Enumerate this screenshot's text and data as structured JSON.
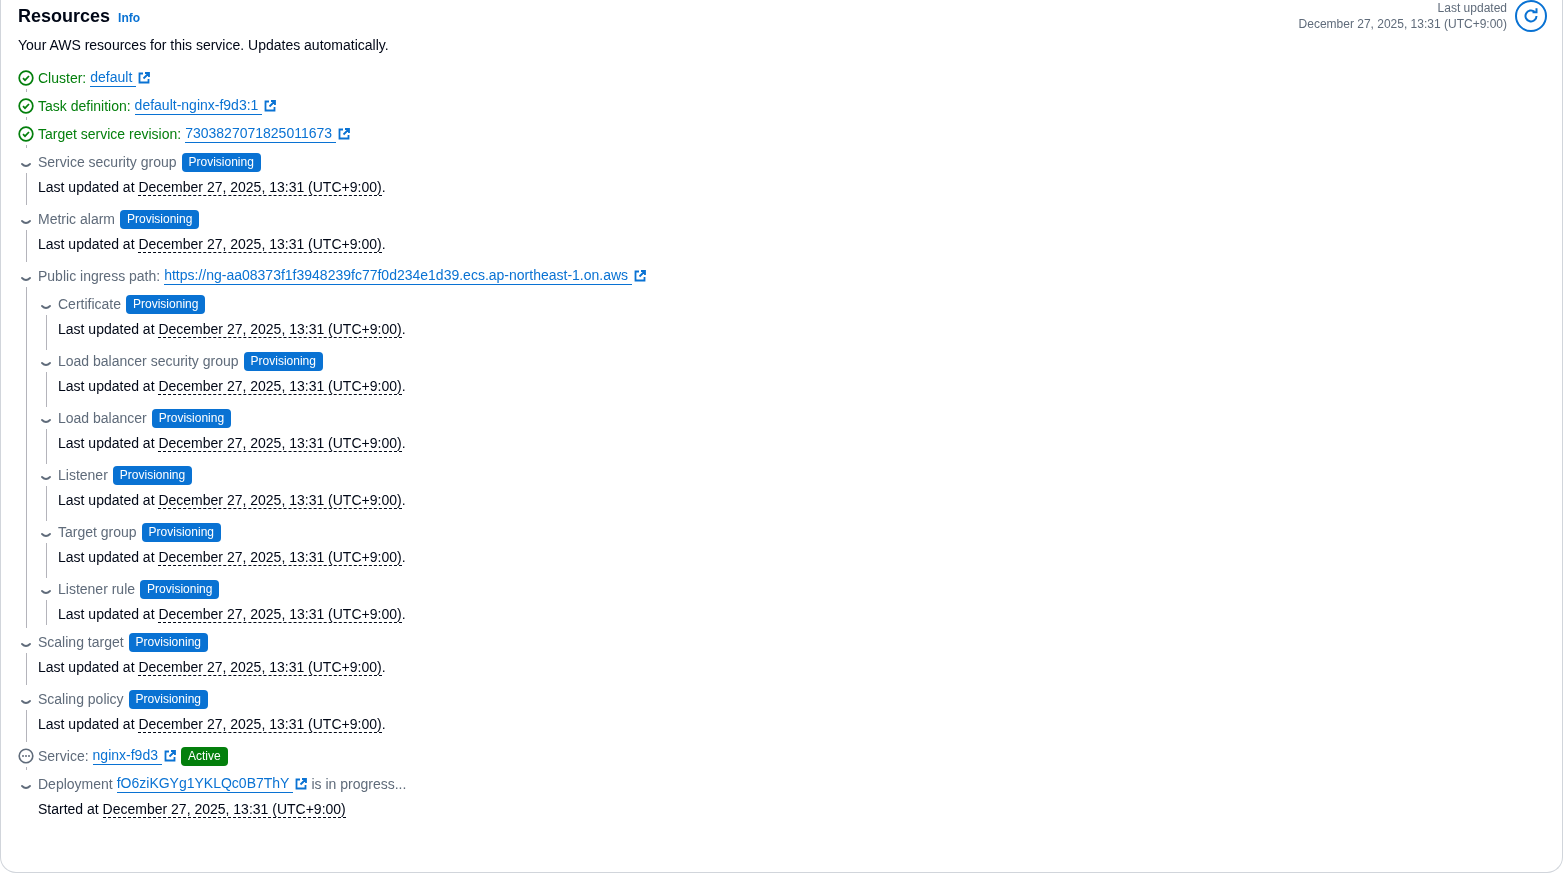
{
  "header": {
    "title": "Resources",
    "info": "Info",
    "description": "Your AWS resources for this service. Updates automatically.",
    "last_updated_label": "Last updated",
    "last_updated_value": "December 27, 2025, 13:31 (UTC+9:00)"
  },
  "items": [
    {
      "kind": "success",
      "label": "Cluster:",
      "link": "default"
    },
    {
      "kind": "success",
      "label": "Task definition:",
      "link": "default-nginx-f9d3:1"
    },
    {
      "kind": "success",
      "label": "Target service revision:",
      "link": "7303827071825011673"
    },
    {
      "kind": "pending",
      "label": "Service security group",
      "badge": {
        "text": "Provisioning",
        "kind": "info"
      },
      "detail": {
        "prefix": "Last updated at",
        "date": "December 27, 2025, 13:31 (UTC+9:00)",
        "suffix": "."
      }
    },
    {
      "kind": "pending",
      "label": "Metric alarm",
      "badge": {
        "text": "Provisioning",
        "kind": "info"
      },
      "detail": {
        "prefix": "Last updated at",
        "date": "December 27, 2025, 13:31 (UTC+9:00)",
        "suffix": "."
      }
    },
    {
      "kind": "pending",
      "label": "Public ingress path:",
      "link": "https://ng-aa08373f1f3948239fc77f0d234e1d39.ecs.ap-northeast-1.on.aws",
      "children": [
        {
          "kind": "pending",
          "label": "Certificate",
          "badge": {
            "text": "Provisioning",
            "kind": "info"
          },
          "detail": {
            "prefix": "Last updated at",
            "date": "December 27, 2025, 13:31 (UTC+9:00)",
            "suffix": "."
          }
        },
        {
          "kind": "pending",
          "label": "Load balancer security group",
          "badge": {
            "text": "Provisioning",
            "kind": "info"
          },
          "detail": {
            "prefix": "Last updated at",
            "date": "December 27, 2025, 13:31 (UTC+9:00)",
            "suffix": "."
          }
        },
        {
          "kind": "pending",
          "label": "Load balancer",
          "badge": {
            "text": "Provisioning",
            "kind": "info"
          },
          "detail": {
            "prefix": "Last updated at",
            "date": "December 27, 2025, 13:31 (UTC+9:00)",
            "suffix": "."
          }
        },
        {
          "kind": "pending",
          "label": "Listener",
          "badge": {
            "text": "Provisioning",
            "kind": "info"
          },
          "detail": {
            "prefix": "Last updated at",
            "date": "December 27, 2025, 13:31 (UTC+9:00)",
            "suffix": "."
          }
        },
        {
          "kind": "pending",
          "label": "Target group",
          "badge": {
            "text": "Provisioning",
            "kind": "info"
          },
          "detail": {
            "prefix": "Last updated at",
            "date": "December 27, 2025, 13:31 (UTC+9:00)",
            "suffix": "."
          }
        },
        {
          "kind": "pending",
          "label": "Listener rule",
          "badge": {
            "text": "Provisioning",
            "kind": "info"
          },
          "detail": {
            "prefix": "Last updated at",
            "date": "December 27, 2025, 13:31 (UTC+9:00)",
            "suffix": "."
          }
        }
      ]
    },
    {
      "kind": "pending",
      "label": "Scaling target",
      "badge": {
        "text": "Provisioning",
        "kind": "info"
      },
      "detail": {
        "prefix": "Last updated at",
        "date": "December 27, 2025, 13:31 (UTC+9:00)",
        "suffix": "."
      }
    },
    {
      "kind": "pending",
      "label": "Scaling policy",
      "badge": {
        "text": "Provisioning",
        "kind": "info"
      },
      "detail": {
        "prefix": "Last updated at",
        "date": "December 27, 2025, 13:31 (UTC+9:00)",
        "suffix": "."
      }
    },
    {
      "kind": "in_progress",
      "label": "Service:",
      "link": "nginx-f9d3",
      "badge": {
        "text": "Active",
        "kind": "success"
      }
    },
    {
      "kind": "pending",
      "label": "Deployment",
      "link": "fO6ziKGYg1YKLQc0B7ThY",
      "after": "is in progress...",
      "detail": {
        "prefix": "Started at",
        "date": "December 27, 2025, 13:31 (UTC+9:00)"
      }
    }
  ]
}
